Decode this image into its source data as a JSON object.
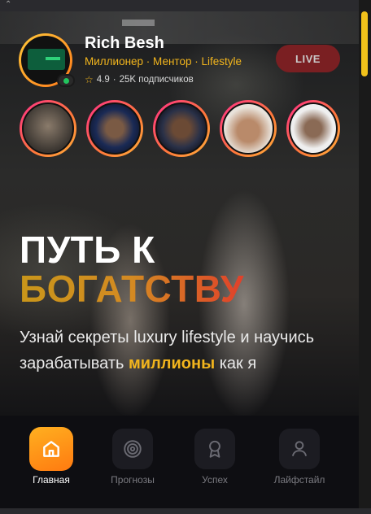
{
  "profile": {
    "name": "Rich Besh",
    "tagline": "Миллионер · Ментор · Lifestyle",
    "rating": "4.9",
    "separator": "·",
    "subscribers": "25K подписчиков"
  },
  "live_button": {
    "label": "LIVE"
  },
  "stories": [
    {
      "name": "story-1"
    },
    {
      "name": "story-2"
    },
    {
      "name": "story-3"
    },
    {
      "name": "story-4"
    },
    {
      "name": "story-5"
    }
  ],
  "hero": {
    "title_line1": "ПУТЬ К",
    "title_line2": "БОГАТСТВУ",
    "subtitle_before": "Узнай секреты luxury lifestyle и научись зарабатывать ",
    "subtitle_highlight": "миллионы",
    "subtitle_after": " как я"
  },
  "nav": [
    {
      "label": "Главная",
      "icon": "home-icon",
      "active": true
    },
    {
      "label": "Прогнозы",
      "icon": "target-icon",
      "active": false
    },
    {
      "label": "Успех",
      "icon": "award-icon",
      "active": false
    },
    {
      "label": "Лайфстайл",
      "icon": "user-icon",
      "active": false
    }
  ],
  "colors": {
    "accent": "#f2b51d",
    "live_bg": "#7a1f22",
    "online": "#22c55e",
    "nav_active": "#ff9a18"
  }
}
